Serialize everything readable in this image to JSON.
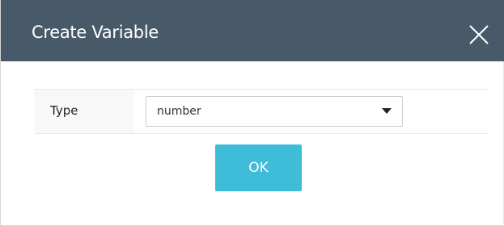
{
  "dialog": {
    "title": "Create Variable",
    "close_icon": "close-icon",
    "header_color": "#485a6a"
  },
  "form": {
    "type_label": "Type",
    "type_select": {
      "selected": "number",
      "arrow_icon": "caret-down-icon"
    }
  },
  "actions": {
    "ok_label": "OK",
    "ok_color": "#3fbcd8"
  }
}
